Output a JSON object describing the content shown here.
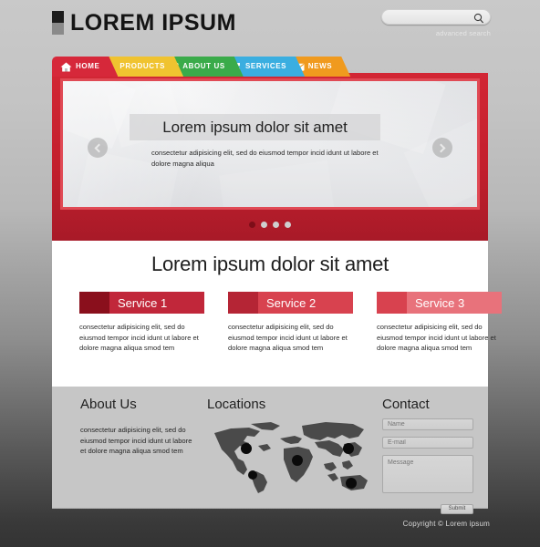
{
  "header": {
    "logo_text": "LOREM IPSUM",
    "logo_icon": "square-blocks-icon",
    "search": {
      "value": "",
      "placeholder": "",
      "icon": "search-icon"
    },
    "advanced_search_label": "advanced search"
  },
  "nav": {
    "items": [
      {
        "label": "HOME",
        "icon": "home-icon",
        "color": "#d6283a",
        "active": true
      },
      {
        "label": "PRODUCTS",
        "icon": "download-icon",
        "color": "#f0c330",
        "active": false
      },
      {
        "label": "ABOUT US",
        "icon": "chat-icon",
        "color": "#3aab4a",
        "active": false
      },
      {
        "label": "SERVICES",
        "icon": "puzzle-icon",
        "color": "#3aaee0",
        "active": false
      },
      {
        "label": "NEWS",
        "icon": "envelope-icon",
        "color": "#f09a1e",
        "active": false
      }
    ]
  },
  "hero": {
    "headline": "Lorem ipsum dolor sit amet",
    "subtext": "consectetur adipisicing elit, sed do eiusmod tempor incid idunt ut labore et dolore magna aliqua",
    "prev_icon": "chevron-left-icon",
    "next_icon": "chevron-right-icon",
    "dots": [
      true,
      false,
      false,
      false
    ],
    "frame_color": "#c31f2d",
    "inner_border_color": "#e04a55"
  },
  "main": {
    "title": "Lorem ipsum dolor sit amet",
    "services": [
      {
        "title": "Service 1",
        "block_color": "#8a0f1c",
        "bar_color": "#c1273a",
        "body": "consectetur adipisicing elit, sed do eiusmod tempor incid idunt ut labore et dolore magna aliqua smod tem"
      },
      {
        "title": "Service 2",
        "block_color": "#b52535",
        "bar_color": "#d8424f",
        "body": "consectetur adipisicing elit, sed do eiusmod tempor incid idunt ut labore et dolore magna aliqua smod tem"
      },
      {
        "title": "Service 3",
        "block_color": "#d8424f",
        "bar_color": "#e8727b",
        "body": "consectetur adipisicing elit, sed do eiusmod tempor incid idunt ut labore et dolore magna aliqua smod tem"
      }
    ]
  },
  "footer": {
    "about": {
      "title": "About Us",
      "body": "consectetur adipisicing elit, sed do eiusmod tempor incid idunt ut labore et dolore magna aliqua smod tem"
    },
    "locations": {
      "title": "Locations",
      "map_icon": "world-map-icon",
      "markers": [
        "north-america",
        "south-america",
        "africa",
        "east-asia",
        "australia"
      ]
    },
    "contact": {
      "title": "Contact",
      "name_placeholder": "Name",
      "name_value": "",
      "email_placeholder": "E-mail",
      "email_value": "",
      "message_placeholder": "Message",
      "message_value": "",
      "submit_label": "Submit"
    }
  },
  "copyright": "Copyright © Lorem ipsum"
}
